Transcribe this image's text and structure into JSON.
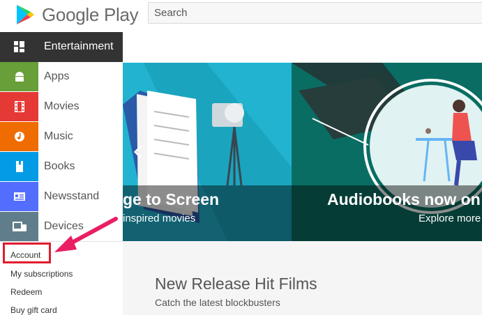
{
  "header": {
    "brand": "Google Play",
    "search_placeholder": "Search"
  },
  "sidebar": {
    "items": [
      {
        "label": "Entertainment",
        "icon": "grid-icon",
        "color": "#333333"
      },
      {
        "label": "Apps",
        "icon": "android-icon",
        "color": "#689f38"
      },
      {
        "label": "Movies",
        "icon": "film-icon",
        "color": "#e53935"
      },
      {
        "label": "Music",
        "icon": "music-note-icon",
        "color": "#ef6c00"
      },
      {
        "label": "Books",
        "icon": "book-icon",
        "color": "#039be5"
      },
      {
        "label": "Newsstand",
        "icon": "newspaper-icon",
        "color": "#536dfe"
      },
      {
        "label": "Devices",
        "icon": "devices-icon",
        "color": "#607d8b"
      }
    ],
    "links": [
      "Account",
      "My subscriptions",
      "Redeem",
      "Buy gift card"
    ]
  },
  "banner": {
    "left_title": "ge to Screen",
    "left_subtitle": "inspired movies",
    "right_title": "Audiobooks now on",
    "right_subtitle": "Explore more"
  },
  "section": {
    "title": "New Release Hit Films",
    "subtitle": "Catch the latest blockbusters"
  },
  "colors": {
    "highlight": "#e01b2e",
    "arrow": "#e91e63"
  }
}
